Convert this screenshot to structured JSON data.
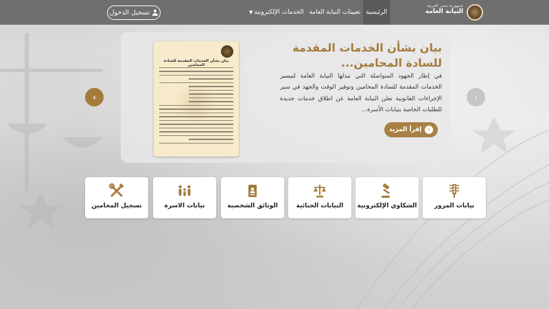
{
  "header": {
    "logo_small": "جمهورية مصر العربية",
    "logo_main": "النيابة العامة",
    "nav": [
      {
        "label": "الرئيسية",
        "active": true
      },
      {
        "label": "تعيينات النيابة العامة",
        "active": false
      },
      {
        "label": "الخدمات الإلكترونية",
        "active": false,
        "dropdown": true
      }
    ],
    "login_label": "تسجيل الدخول"
  },
  "hero": {
    "title": "بيان بشأن الخدمات المقدمة للسادة المحامين...",
    "body": "في إطار الجهود المتواصلة التي تبذلها النيابة العامة لتيسير الخدمات المقدمة للسادة المحامين وتوفير الوقت والجهد في سير الإجراءات القانونية تعلن النيابة العامة عن اطلاق خدمات جديدة للطلبات الخاصة بنيابات الأسرة...",
    "more_label": "إقرأ المزيد",
    "doc_title": "بيان بشأن الخدمات المقدمة للسادة المحامين"
  },
  "services": [
    {
      "label": "نيابات المرور",
      "icon": "traffic-light-icon"
    },
    {
      "label": "الشكاوي الإلكترونية",
      "icon": "gavel-icon"
    },
    {
      "label": "النيابات الجنائية",
      "icon": "scales-icon"
    },
    {
      "label": "الوثائق الشخصية",
      "icon": "id-card-icon"
    },
    {
      "label": "نيابات الاسرة",
      "icon": "family-icon"
    },
    {
      "label": "تسجيل المحامين",
      "icon": "tools-icon"
    }
  ],
  "colors": {
    "accent": "#a47b3c",
    "topbar": "#6f6f6f"
  }
}
